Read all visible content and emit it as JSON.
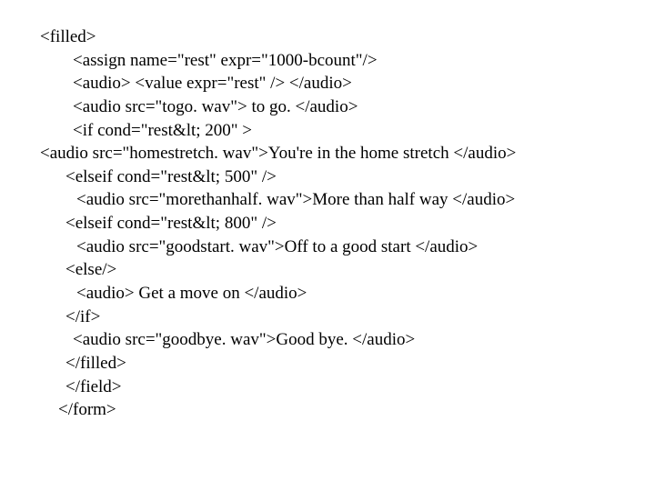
{
  "lines": {
    "l1": "<filled>",
    "l2": "<assign name=\"rest\" expr=\"1000-bcount\"/>",
    "l3": "<audio> <value expr=\"rest\" /> </audio>",
    "l4": "<audio src=\"togo. wav\"> to go. </audio>",
    "l5": "<if cond=\"rest&lt; 200\" >",
    "l6": "<audio src=\"homestretch. wav\">You're in the home stretch </audio>",
    "l7": "<elseif cond=\"rest&lt; 500\" />",
    "l8": "<audio src=\"morethanhalf. wav\">More than half way </audio>",
    "l9": "<elseif cond=\"rest&lt; 800\" />",
    "l10": "<audio src=\"goodstart. wav\">Off to a good start </audio>",
    "l11": "<else/>",
    "l12": "<audio> Get a move on </audio>",
    "l13": "</if>",
    "l14": "<audio src=\"goodbye. wav\">Good bye. </audio>",
    "l15": "</filled>",
    "l16": "</field>",
    "l17": "</form>"
  }
}
